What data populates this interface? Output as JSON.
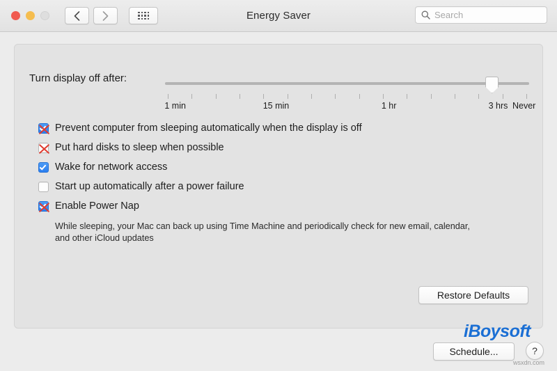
{
  "window": {
    "title": "Energy Saver",
    "traffic_lights": [
      "close",
      "minimize",
      "zoom-disabled"
    ],
    "back_label": "Back",
    "forward_label": "Forward",
    "grid_label": "Show All"
  },
  "search": {
    "placeholder": "Search",
    "value": "",
    "icon": "search-icon"
  },
  "slider": {
    "label": "Turn display off after:",
    "tick_labels": [
      {
        "text": "1 min",
        "pos_pct": 2.8
      },
      {
        "text": "15 min",
        "pos_pct": 30.5
      },
      {
        "text": "1 hr",
        "pos_pct": 61.5
      },
      {
        "text": "3 hrs",
        "pos_pct": 91.5
      },
      {
        "text": "Never",
        "pos_pct": 100
      }
    ],
    "tick_count": 16,
    "thumb_pos_pct": 88,
    "current_value": "3 hrs"
  },
  "options": [
    {
      "label": "Prevent computer from sleeping automatically when the display is off",
      "checked": true,
      "marked": true
    },
    {
      "label": "Put hard disks to sleep when possible",
      "checked": false,
      "marked": true
    },
    {
      "label": "Wake for network access",
      "checked": true,
      "marked": false
    },
    {
      "label": "Start up automatically after a power failure",
      "checked": false,
      "marked": false
    },
    {
      "label": "Enable Power Nap",
      "checked": true,
      "marked": true,
      "description": "While sleeping, your Mac can back up using Time Machine and periodically check for new email, calendar, and other iCloud updates"
    }
  ],
  "buttons": {
    "restore_defaults": "Restore Defaults",
    "schedule": "Schedule...",
    "help": "?"
  },
  "branding": {
    "logo_text": "iBoysoft",
    "logo_color": "#1b6fd4",
    "watermark": "wsxdn.com"
  },
  "colors": {
    "window_bg": "#ececec",
    "panel_bg": "#e3e3e3",
    "checkbox_blue": "#2b7ff0",
    "mark_red": "#e03b2f"
  }
}
